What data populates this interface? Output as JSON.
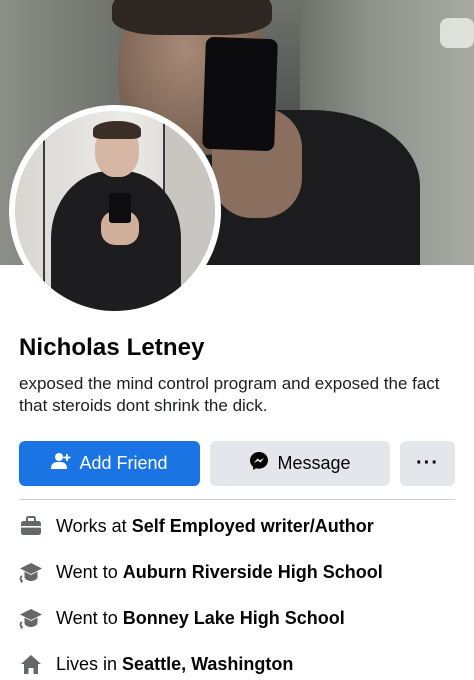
{
  "profile": {
    "name": "Nicholas Letney",
    "bio": "exposed the mind control program and exposed the fact that steroids dont shrink the dick."
  },
  "actions": {
    "add_friend": {
      "label": "Add Friend",
      "icon": "add-person-icon",
      "color": "#1b74e4"
    },
    "message": {
      "label": "Message",
      "icon": "messenger-icon"
    },
    "more": {
      "label": "···",
      "icon": "more-icon"
    }
  },
  "about": {
    "items": [
      {
        "icon": "briefcase-icon",
        "prefix": "Works at",
        "value": "Self Employed writer/Author"
      },
      {
        "icon": "graduation-cap-icon",
        "prefix": "Went to",
        "value": "Auburn Riverside High School"
      },
      {
        "icon": "graduation-cap-icon",
        "prefix": "Went to",
        "value": "Bonney Lake High School"
      },
      {
        "icon": "home-icon",
        "prefix": "Lives in",
        "value": "Seattle, Washington"
      }
    ]
  }
}
